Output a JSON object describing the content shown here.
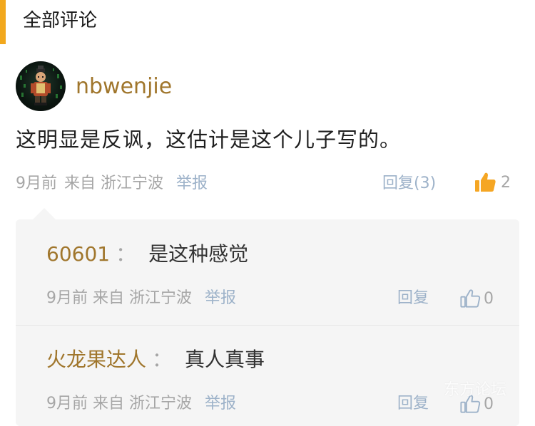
{
  "section": {
    "title": "全部评论"
  },
  "comment": {
    "username": "nbwenjie",
    "text": "这明显是反讽，这估计是这个儿子写的。",
    "time": "9月前",
    "location": "来自 浙江宁波",
    "report": "举报",
    "reply_count": "回复(3)",
    "likes": "2"
  },
  "replies": [
    {
      "author": "60601",
      "colon": "：",
      "content": "是这种感觉",
      "time": "9月前",
      "location": "来自 浙江宁波",
      "report": "举报",
      "reply": "回复",
      "likes": "0"
    },
    {
      "author": "火龙果达人",
      "colon": "：",
      "content": "真人真事",
      "time": "9月前",
      "location": "来自 浙江宁波",
      "report": "举报",
      "reply": "回复",
      "likes": "0"
    }
  ],
  "watermark": "东方论坛",
  "colors": {
    "accent": "#f2a81d",
    "username": "#a0762c",
    "link": "#9db2c9",
    "meta": "#a6a6a6",
    "like_active": "#f5a623"
  },
  "icons": {
    "like_active": "thumbs-up-filled-icon",
    "like_outline": "thumbs-up-outline-icon"
  }
}
